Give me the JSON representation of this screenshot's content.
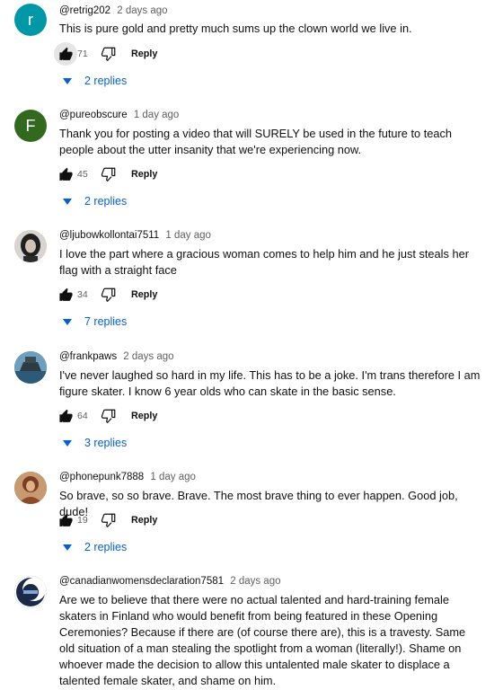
{
  "comments": [
    {
      "handle": "@retrig202",
      "time": "2 days ago",
      "text": "This is pure gold and pretty much sums up the clown world we live in.",
      "likes": "71",
      "reply_label": "Reply",
      "replies": "2 replies",
      "avatar_letter": "r",
      "avatar_color": "#0097a7"
    },
    {
      "handle": "@pureobscure",
      "time": "1 day ago",
      "text": "Thank you for posting a video that will SURELY be used in the future to teach people about the utter insanity that we're experiencing now.",
      "likes": "45",
      "reply_label": "Reply",
      "replies": "2 replies",
      "avatar_letter": "F",
      "avatar_color": "#33691e"
    },
    {
      "handle": "@ljubowkollontai7511",
      "time": "1 day ago",
      "text": "I love the part where a gracious woman comes to help him and he just steals her flag with a straight face",
      "likes": "34",
      "reply_label": "Reply",
      "replies": "7 replies",
      "avatar_color": "#d8d4cf"
    },
    {
      "handle": "@frankpaws",
      "time": "2 days ago",
      "text": "I've never laughed so hard in my life.  This has to be a joke.  I'm trans therefore I am figure skater.  I know 6 year olds who can skate in the basic sense.",
      "likes": "64",
      "reply_label": "Reply",
      "replies": "3 replies",
      "avatar_color": "#3d6f8f"
    },
    {
      "handle": "@phonepunk7888",
      "time": "1 day ago",
      "text": "So brave, so so brave. Brave. The most brave thing to ever happen. Good job, dude!",
      "likes": "19",
      "reply_label": "Reply",
      "replies": "2 replies",
      "avatar_color": "#a3623f"
    },
    {
      "handle": "@canadianwomensdeclaration7581",
      "time": "2 days ago",
      "text": "Are we to believe that there were no actual talented and hard-training female skaters in Finland who would benefit from being featured in these Opening Ceremonies? Because if there are (of course there are), this is a travesty. Same old situation of a man stealing the spotlight from a woman (literally!). Shame on whoever made the decision to allow this untalented male skater to displace a talented female skater, and shame on him.",
      "avatar_color": "#1c2a4a"
    }
  ],
  "colors": {
    "link": "#065fd4",
    "meta": "#606060"
  }
}
